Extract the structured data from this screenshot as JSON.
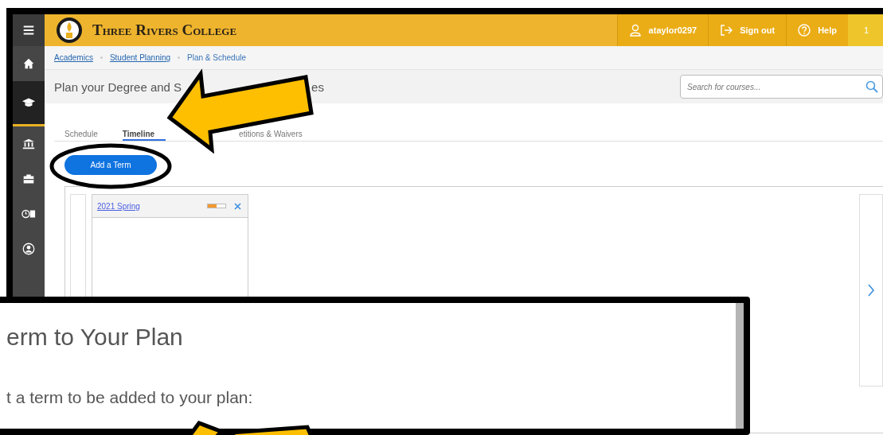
{
  "sidebar": {
    "items": [
      {
        "kind": "menu",
        "selected": false
      },
      {
        "kind": "home",
        "selected": false
      },
      {
        "kind": "graduation",
        "selected": true
      },
      {
        "kind": "bank",
        "selected": false
      },
      {
        "kind": "briefcase",
        "selected": false
      },
      {
        "kind": "finance",
        "selected": false
      },
      {
        "kind": "user",
        "selected": false
      }
    ]
  },
  "header": {
    "college_name": "Three Rivers College",
    "user": "ataylor0297",
    "sign_out": "Sign out",
    "help": "Help",
    "column_4": "1"
  },
  "breadcrumb": [
    {
      "label": "Academics",
      "link": true
    },
    {
      "label": "Student Planning",
      "link": true
    },
    {
      "label": "Plan & Schedule",
      "link": false
    }
  ],
  "page_title_parts": [
    "Plan your Degree and S",
    "es"
  ],
  "search": {
    "placeholder": "Search for courses..."
  },
  "tabs": [
    {
      "label": "Schedule",
      "selected": false
    },
    {
      "label": "Timeline",
      "selected": true
    },
    {
      "label": "etitions & Waivers",
      "selected": false
    }
  ],
  "add_term_button": "Add a Term",
  "terms": [
    {
      "name": "2021 Spring",
      "level": 0.5
    }
  ],
  "dialog": {
    "title": "erm to Your Plan",
    "prompt": "t a term to be added to your plan:"
  }
}
